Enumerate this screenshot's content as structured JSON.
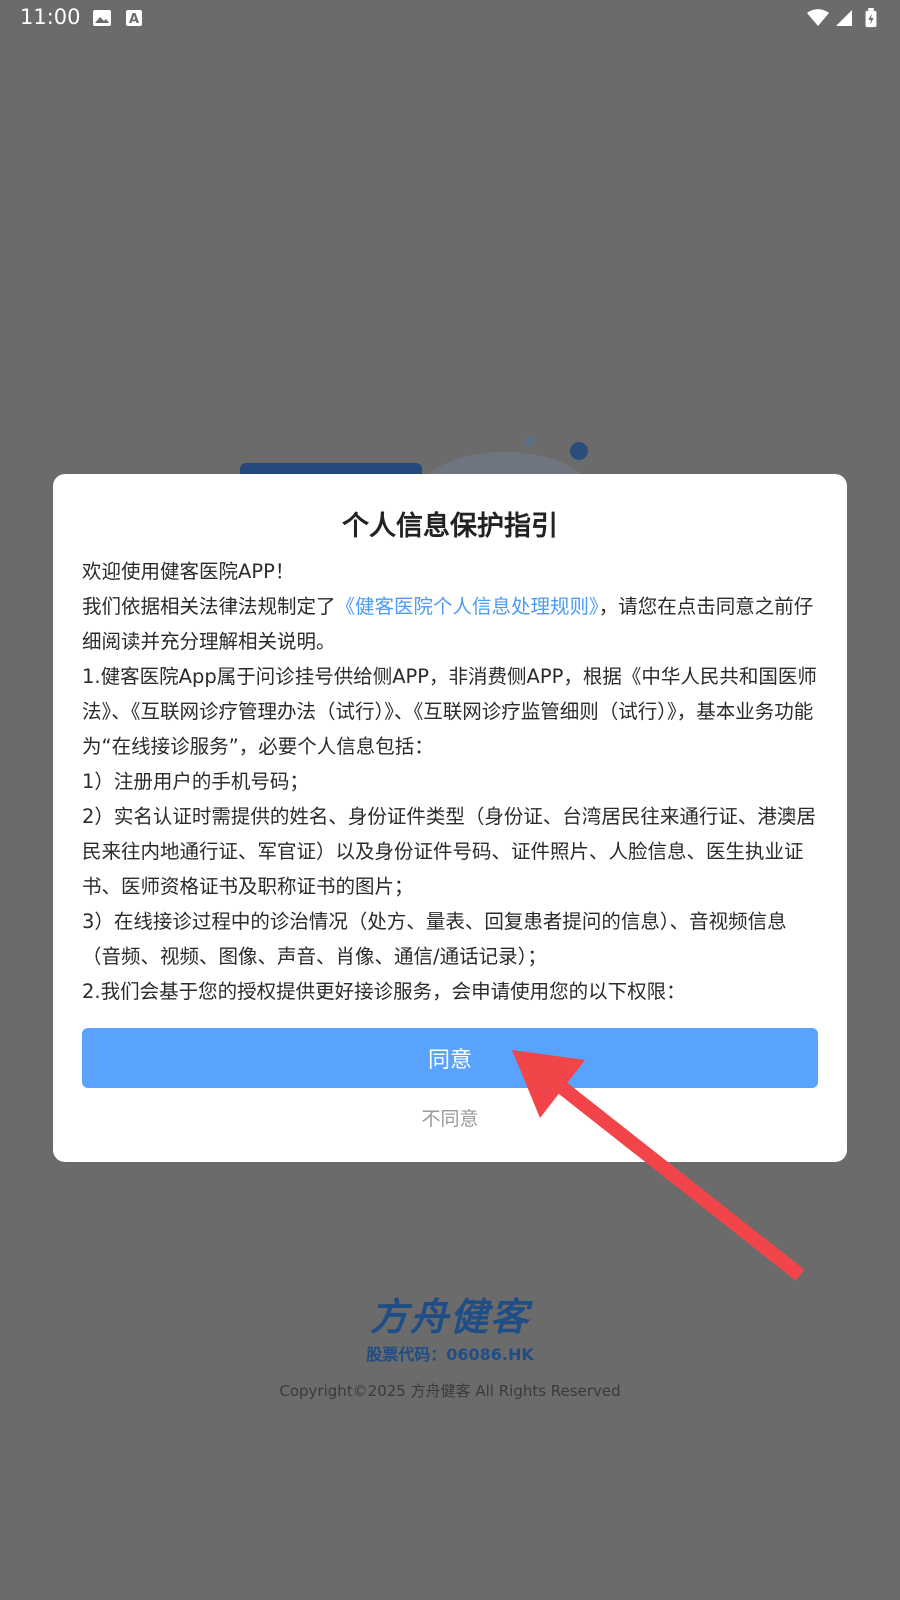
{
  "status_bar": {
    "time": "11:00",
    "icons": [
      "image-icon",
      "text-a-icon",
      "wifi-icon",
      "signal-icon",
      "battery-icon"
    ]
  },
  "dialog": {
    "title": "个人信息保护指引",
    "welcome": "欢迎使用健客医院APP！",
    "intro_before_link": "我们依据相关法律法规制定了",
    "policy_link": "《健客医院个人信息处理规则》",
    "intro_after_link": "，请您在点击同意之前仔细阅读并充分理解相关说明。",
    "item_1": "1.健客医院App属于问诊挂号供给侧APP，非消费侧APP，根据《中华人民共和国医师法》、《互联网诊疗管理办法（试行）》、《互联网诊疗监管细则（试行）》，基本业务功能为“在线接诊服务”，必要个人信息包括：",
    "item_1_1": "1）注册用户的手机号码；",
    "item_1_2": "2）实名认证时需提供的姓名、身份证件类型（身份证、台湾居民往来通行证、港澳居民来往内地通行证、军官证）以及身份证件号码、证件照片、人脸信息、医生执业证书、医师资格证书及职称证书的图片；",
    "item_1_3": "3）在线接诊过程中的诊治情况（处方、量表、回复患者提问的信息）、音视频信息（音频、视频、图像、声音、肖像、通信/通话记录）；",
    "item_2": "2.我们会基于您的授权提供更好接诊服务，会申请使用您的以下权限：",
    "agree_label": "同意",
    "disagree_label": "不同意"
  },
  "footer": {
    "logo_text": "方舟健客",
    "stock_code": "股票代码：06086.HK",
    "copyright": "Copyright©2025 方舟健客 All Rights Reserved"
  },
  "colors": {
    "overlay": "#6b6b6b",
    "accent": "#59a3ff",
    "link": "#4d9cf4",
    "brand": "#1f4d86",
    "arrow": "#f2454a"
  }
}
